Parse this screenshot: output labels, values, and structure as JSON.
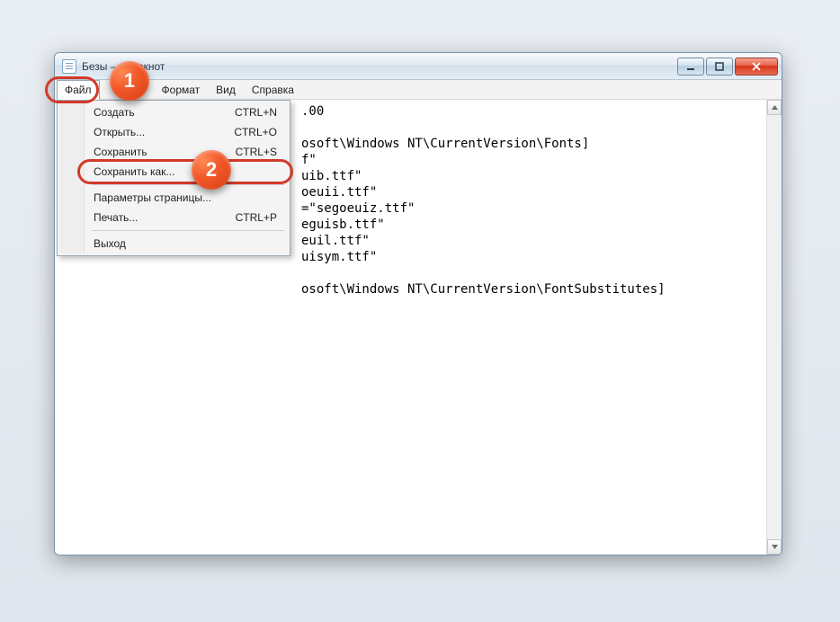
{
  "window": {
    "title_prefix": "Безы",
    "title_suffix": " — Блокнот"
  },
  "menubar": {
    "file": "Файл",
    "format": "Формат",
    "view": "Вид",
    "help": "Справка"
  },
  "dropdown": {
    "new": {
      "label": "Создать",
      "accel": "CTRL+N"
    },
    "open": {
      "label": "Открыть...",
      "accel": "CTRL+O"
    },
    "save": {
      "label": "Сохранить",
      "accel": "CTRL+S"
    },
    "save_as": {
      "label": "Сохранить как...",
      "accel": ""
    },
    "page_setup": {
      "label": "Параметры страницы...",
      "accel": ""
    },
    "print": {
      "label": "Печать...",
      "accel": "CTRL+P"
    },
    "exit": {
      "label": "Выход",
      "accel": ""
    }
  },
  "editor": {
    "lines": [
      ".00",
      "",
      "osoft\\Windows NT\\CurrentVersion\\Fonts]",
      "f\"",
      "uib.ttf\"",
      "oeuii.ttf\"",
      "=\"segoeuiz.ttf\"",
      "eguisb.ttf\"",
      "euil.ttf\"",
      "uisym.ttf\"",
      "",
      "osoft\\Windows NT\\CurrentVersion\\FontSubstitutes]"
    ]
  },
  "badges": {
    "one": "1",
    "two": "2"
  }
}
